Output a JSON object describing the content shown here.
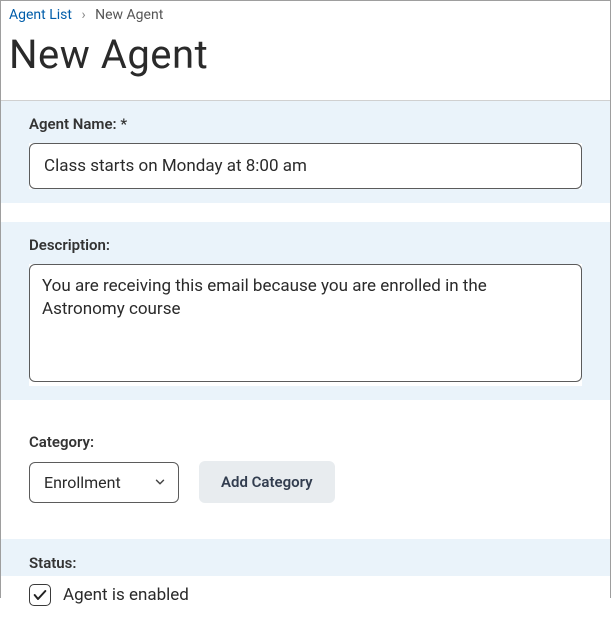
{
  "breadcrumb": {
    "root": "Agent List",
    "current": "New Agent"
  },
  "page_title": "New Agent",
  "fields": {
    "name": {
      "label": "Agent Name:",
      "required_mark": "*",
      "value": "Class starts on Monday at 8:00 am"
    },
    "description": {
      "label": "Description:",
      "value": "You are receiving this email because you are enrolled in the Astronomy course"
    },
    "category": {
      "label": "Category:",
      "selected": "Enrollment",
      "add_button": "Add Category"
    },
    "status": {
      "label": "Status:",
      "checkbox_label": "Agent is enabled",
      "checked": true
    }
  }
}
